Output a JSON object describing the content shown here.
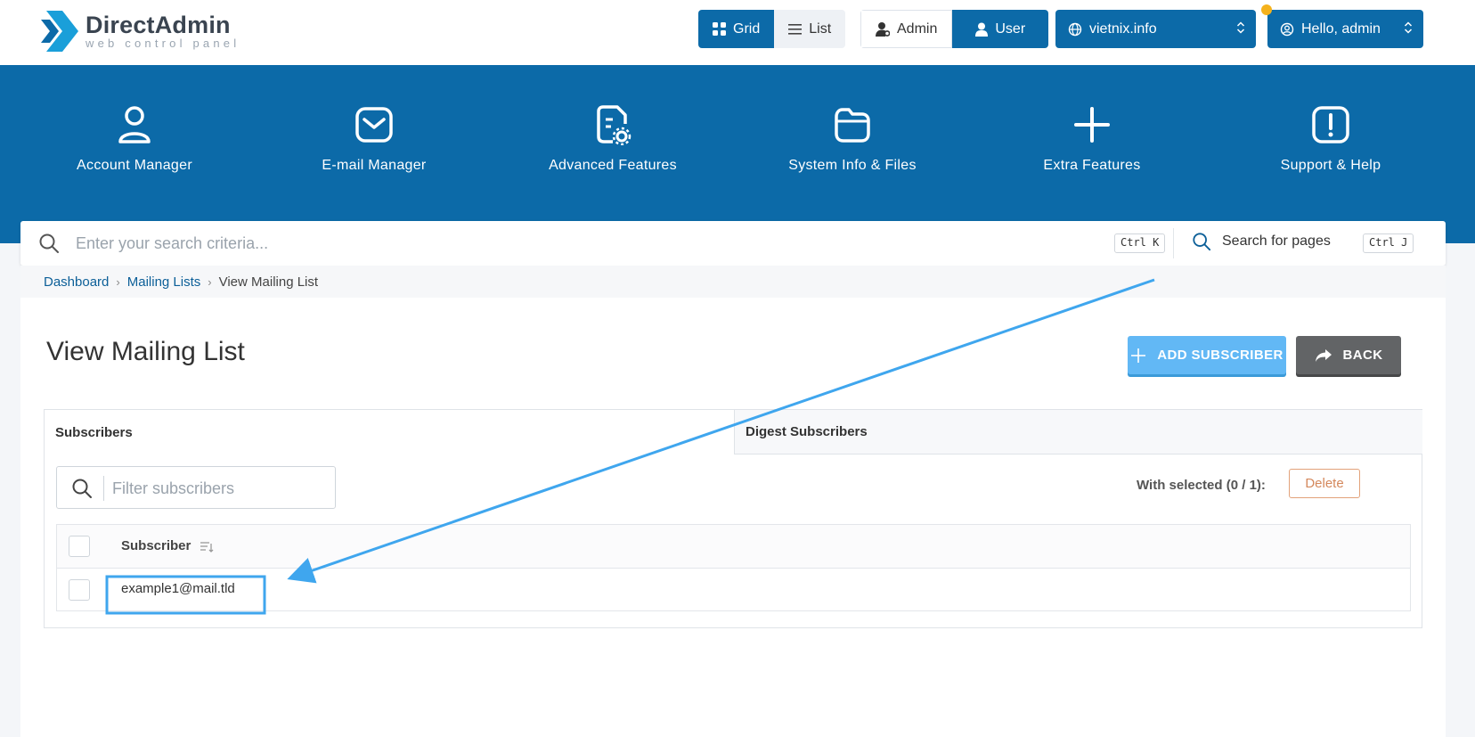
{
  "logo": {
    "title": "DirectAdmin",
    "subtitle": "web control panel"
  },
  "view_toggle": {
    "grid": "Grid",
    "list": "List"
  },
  "role_toggle": {
    "admin": "Admin",
    "user": "User"
  },
  "domain_select": {
    "value": "vietnix.info"
  },
  "user_menu": {
    "label": "Hello, admin"
  },
  "nav": [
    {
      "label": "Account Manager",
      "icon": "user-icon"
    },
    {
      "label": "E-mail Manager",
      "icon": "mail-icon"
    },
    {
      "label": "Advanced Features",
      "icon": "file-settings-icon"
    },
    {
      "label": "System Info & Files",
      "icon": "folder-icon"
    },
    {
      "label": "Extra Features",
      "icon": "plus-icon"
    },
    {
      "label": "Support & Help",
      "icon": "alert-icon"
    }
  ],
  "search": {
    "placeholder": "Enter your search criteria...",
    "shortcut": "Ctrl K",
    "page_search_label": "Search for pages",
    "page_search_shortcut": "Ctrl J"
  },
  "breadcrumb": {
    "items": [
      "Dashboard",
      "Mailing Lists"
    ],
    "current": "View Mailing List"
  },
  "page": {
    "title": "View Mailing List"
  },
  "actions": {
    "add_subscriber": "ADD SUBSCRIBER",
    "back": "BACK"
  },
  "tabs": [
    "Subscribers",
    "Digest Subscribers"
  ],
  "filter": {
    "placeholder": "Filter subscribers"
  },
  "selection": {
    "text": "With selected (0 / 1):",
    "delete": "Delete"
  },
  "table": {
    "columns": [
      "Subscriber"
    ],
    "rows": [
      {
        "subscriber": "example1@mail.tld"
      }
    ]
  },
  "colors": {
    "primary": "#0c6aa8",
    "add_button": "#62b8f5",
    "back_button": "#626466",
    "annotation": "#3fa6ee",
    "notification": "#f5b21c"
  }
}
